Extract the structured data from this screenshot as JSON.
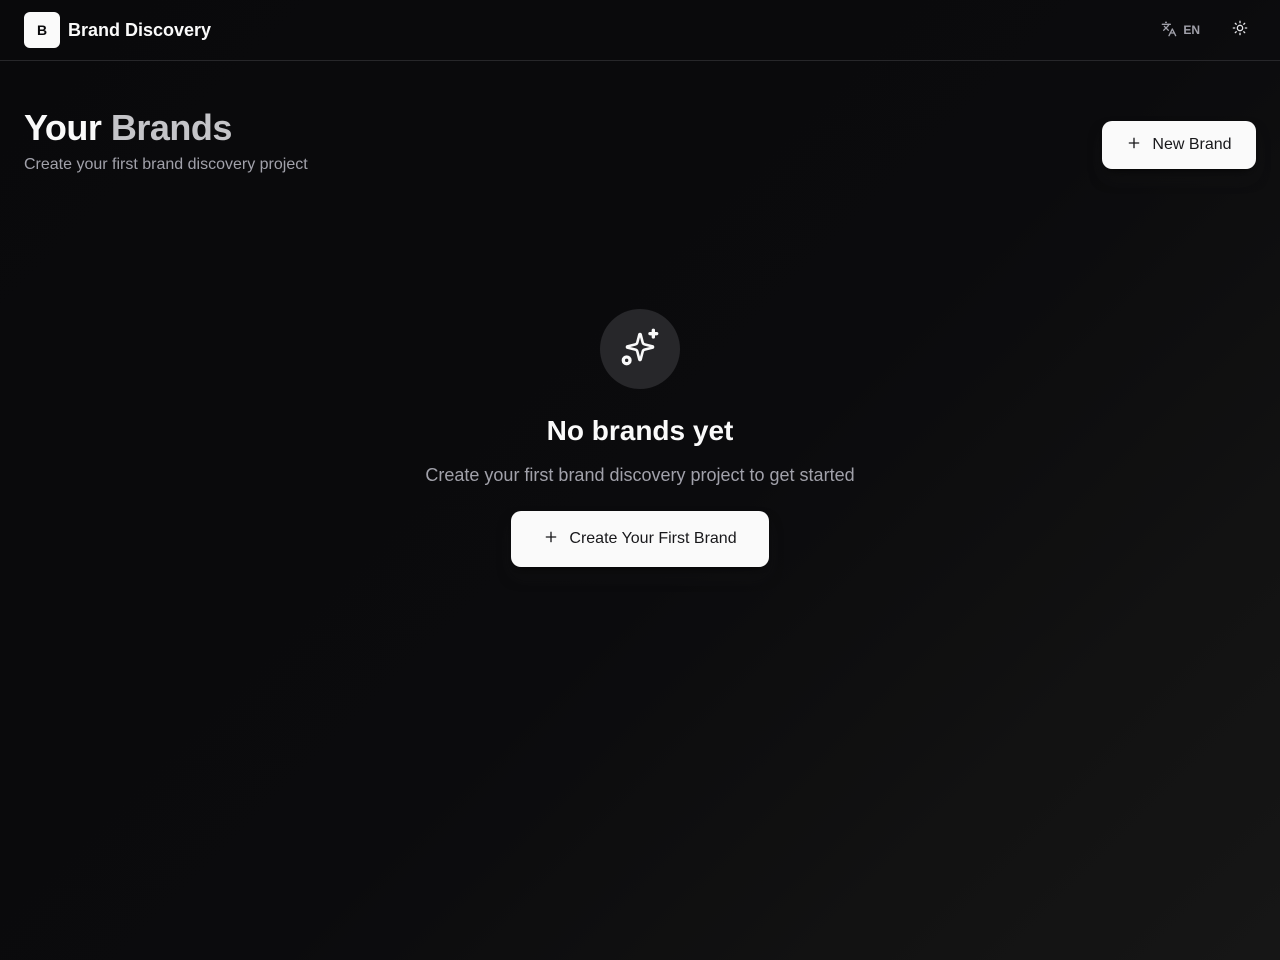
{
  "header": {
    "logo_letter": "B",
    "app_title": "Brand Discovery",
    "language": "EN",
    "language_icon": "translate-icon",
    "theme_icon": "sun-icon"
  },
  "page": {
    "title_part1": "Your",
    "title_part2": "Brands",
    "subtitle": "Create your first brand discovery project",
    "new_brand_label": "New Brand",
    "new_brand_icon": "plus-icon"
  },
  "empty_state": {
    "icon": "sparkles-icon",
    "title": "No brands yet",
    "description": "Create your first brand discovery project to get started",
    "cta_label": "Create Your First Brand",
    "cta_icon": "plus-icon"
  },
  "colors": {
    "background": "#09090b",
    "foreground": "#fafafa",
    "muted": "#a1a1aa",
    "button_bg": "#fafafa",
    "button_text": "#18181b"
  }
}
